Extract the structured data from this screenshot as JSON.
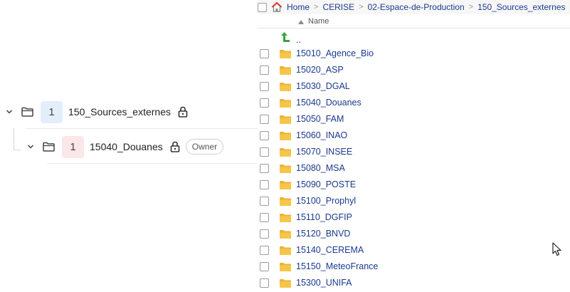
{
  "tree": {
    "rows": [
      {
        "count": "1",
        "name": "150_Sources_externes"
      },
      {
        "count": "1",
        "name": "15040_Douanes",
        "badge": "Owner"
      }
    ]
  },
  "browser": {
    "breadcrumb": [
      "Home",
      "CERISE",
      "02-Espace-de-Production",
      "150_Sources_externes"
    ],
    "column_header": "Name",
    "parent_label": "..",
    "folders": [
      "15010_Agence_Bio",
      "15020_ASP",
      "15030_DGAL",
      "15040_Douanes",
      "15050_FAM",
      "15060_INAO",
      "15070_INSEE",
      "15080_MSA",
      "15090_POSTE",
      "15100_Prophyl",
      "15110_DGFIP",
      "15120_BNVD",
      "15140_CEREMA",
      "15150_MeteoFrance",
      "15300_UNIFA"
    ]
  },
  "colors": {
    "link": "#1a3a8f",
    "folder": "#f6c64a",
    "home": "#d9342b",
    "up_arrow": "#3aa23a",
    "count_blue": "#e3eefb",
    "count_pink": "#fbe6e8"
  },
  "icons": [
    "chevron-down-icon",
    "folder-outline-icon",
    "lock-icon",
    "home-icon",
    "sort-up-icon",
    "parent-folder-icon",
    "folder-icon",
    "mouse-cursor-icon"
  ]
}
